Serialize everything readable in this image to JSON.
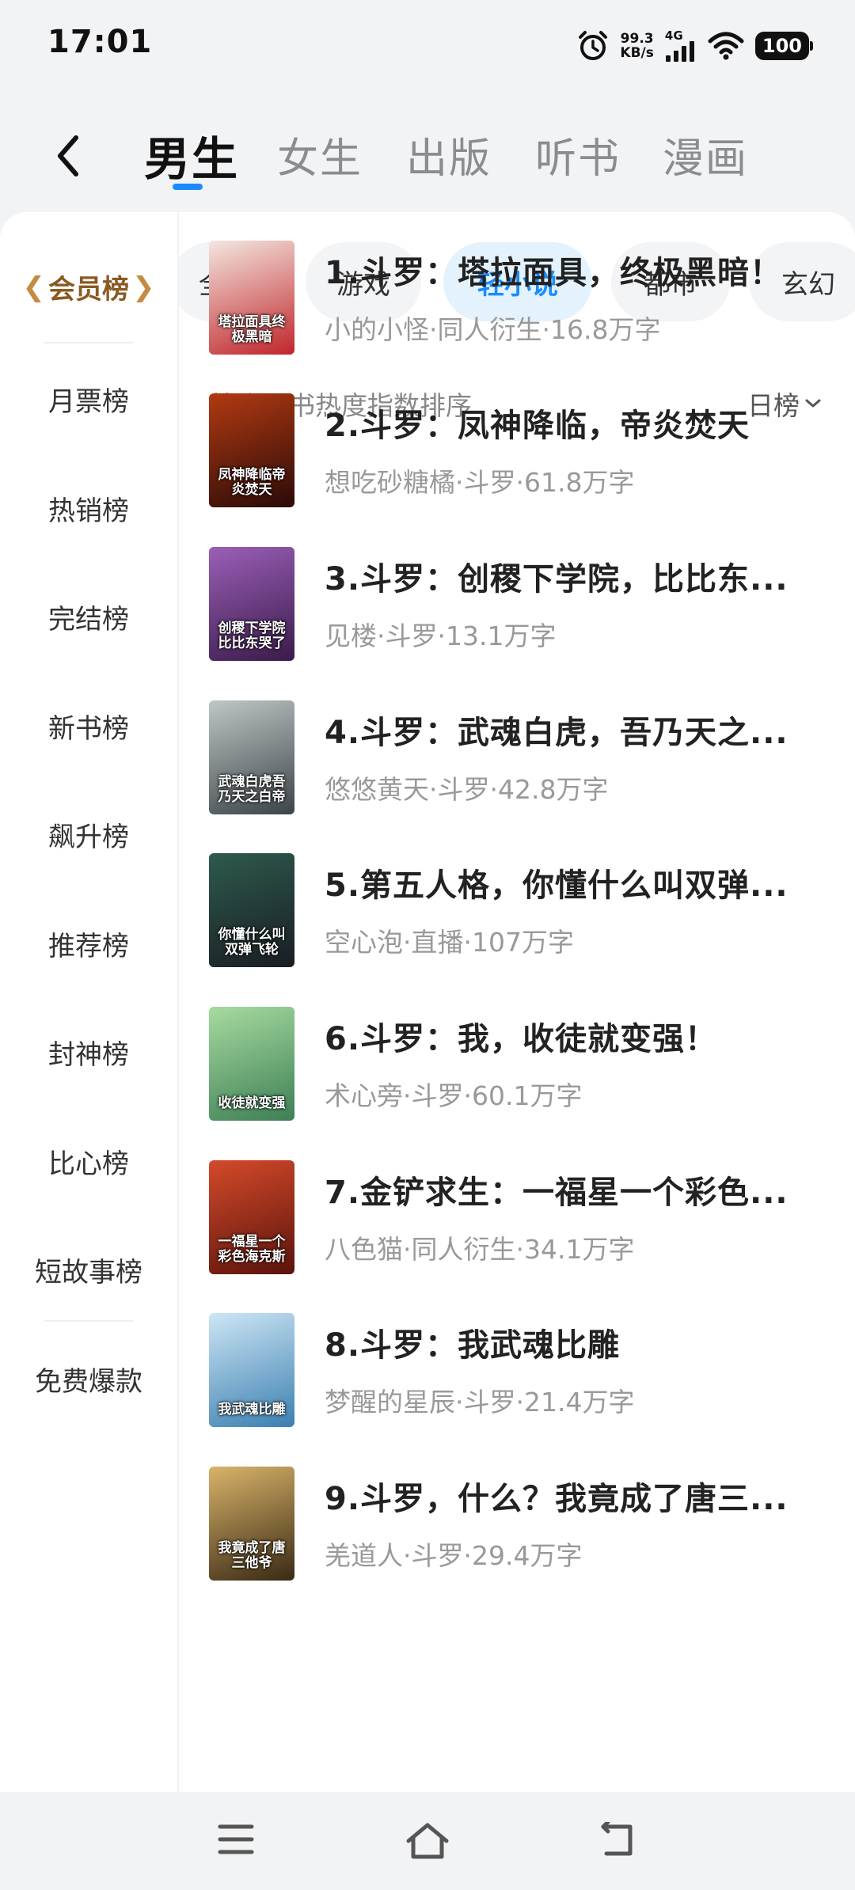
{
  "status": {
    "time": "17:01",
    "net_speed_value": "99.3",
    "net_speed_unit": "KB/s",
    "network": "4G",
    "battery": "100"
  },
  "top_tabs": [
    {
      "label": "男生",
      "active": true
    },
    {
      "label": "女生",
      "active": false
    },
    {
      "label": "出版",
      "active": false
    },
    {
      "label": "听书",
      "active": false
    },
    {
      "label": "漫画",
      "active": false
    }
  ],
  "sidebar": {
    "items": [
      {
        "label": "会员榜",
        "active": true
      },
      {
        "label": "月票榜",
        "active": false
      },
      {
        "label": "热销榜",
        "active": false
      },
      {
        "label": "完结榜",
        "active": false
      },
      {
        "label": "新书榜",
        "active": false
      },
      {
        "label": "飙升榜",
        "active": false
      },
      {
        "label": "推荐榜",
        "active": false
      },
      {
        "label": "封神榜",
        "active": false
      },
      {
        "label": "比心榜",
        "active": false
      },
      {
        "label": "短故事榜",
        "active": false
      },
      {
        "label": "免费爆款",
        "active": false
      }
    ]
  },
  "chips": [
    {
      "label": "全部",
      "active": false
    },
    {
      "label": "游戏",
      "active": false
    },
    {
      "label": "轻小说",
      "active": true
    },
    {
      "label": "都市",
      "active": false
    },
    {
      "label": "玄幻",
      "active": false
    }
  ],
  "sort_label": "按会员书热度指数排序",
  "range_select": "日榜",
  "books": [
    {
      "title": "1.斗罗：塔拉面具，终极黑暗！",
      "meta": "小的小怪·同人衍生·16.8万字",
      "cover_text": "塔拉面具终极黑暗",
      "cover_colors": [
        "#f4e6e0",
        "#c0262b"
      ]
    },
    {
      "title": "2.斗罗：凤神降临，帝炎焚天",
      "meta": "想吃砂糖橘·斗罗·61.8万字",
      "cover_text": "凤神降临帝炎焚天",
      "cover_colors": [
        "#b23a12",
        "#2a0a08"
      ]
    },
    {
      "title": "3.斗罗：创稷下学院，比比东...",
      "meta": "见楼·斗罗·13.1万字",
      "cover_text": "创稷下学院比比东哭了",
      "cover_colors": [
        "#9b5fb8",
        "#3a1b4a"
      ]
    },
    {
      "title": "4.斗罗：武魂白虎，吾乃天之...",
      "meta": "悠悠黄天·斗罗·42.8万字",
      "cover_text": "武魂白虎吾乃天之白帝",
      "cover_colors": [
        "#bfc6c6",
        "#3b4448"
      ]
    },
    {
      "title": "5.第五人格，你懂什么叫双弹...",
      "meta": "空心泡·直播·107万字",
      "cover_text": "你懂什么叫双弹飞轮",
      "cover_colors": [
        "#2d5a4e",
        "#1a1d22"
      ]
    },
    {
      "title": "6.斗罗：我，收徒就变强！",
      "meta": "术心旁·斗罗·60.1万字",
      "cover_text": "收徒就变强",
      "cover_colors": [
        "#a7dba0",
        "#3d7f55"
      ]
    },
    {
      "title": "7.金铲求生：一福星一个彩色...",
      "meta": "八色猫·同人衍生·34.1万字",
      "cover_text": "一福星一个彩色海克斯",
      "cover_colors": [
        "#d44a2a",
        "#5a130c"
      ]
    },
    {
      "title": "8.斗罗：我武魂比雕",
      "meta": "梦醒的星辰·斗罗·21.4万字",
      "cover_text": "我武魂比雕",
      "cover_colors": [
        "#cde6f5",
        "#3b7fb0"
      ]
    },
    {
      "title": "9.斗罗，什么？我竟成了唐三...",
      "meta": "羌道人·斗罗·29.4万字",
      "cover_text": "我竟成了唐三他爷",
      "cover_colors": [
        "#d9b46a",
        "#3a2a14"
      ]
    }
  ]
}
